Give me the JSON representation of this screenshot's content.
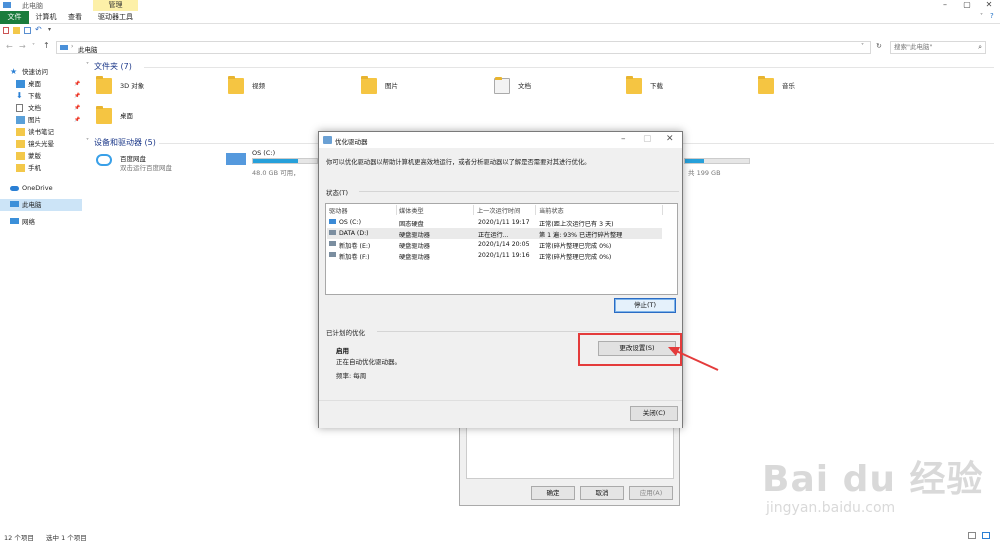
{
  "window": {
    "title": "此电脑",
    "manage_tab": "管理"
  },
  "ribbon": {
    "tabs": [
      "文件",
      "计算机",
      "查看",
      "驱动器工具"
    ]
  },
  "address": {
    "path": "此电脑",
    "search_placeholder": "搜索\"此电脑\""
  },
  "sidebar": {
    "items": [
      {
        "label": "快速访问",
        "level": 0
      },
      {
        "label": "桌面",
        "level": 1,
        "pinned": true
      },
      {
        "label": "下载",
        "level": 1,
        "pinned": true
      },
      {
        "label": "文档",
        "level": 1,
        "pinned": true
      },
      {
        "label": "图片",
        "level": 1,
        "pinned": true
      },
      {
        "label": "读书笔记",
        "level": 1
      },
      {
        "label": "镜头光晕",
        "level": 1
      },
      {
        "label": "蒙版",
        "level": 1
      },
      {
        "label": "手机",
        "level": 1
      },
      {
        "label": "OneDrive",
        "level": 0
      },
      {
        "label": "此电脑",
        "level": 0,
        "selected": true
      },
      {
        "label": "网络",
        "level": 0
      }
    ]
  },
  "folders": {
    "heading": "文件夹 (7)",
    "items": [
      "3D 对象",
      "视频",
      "图片",
      "文档",
      "下载",
      "音乐",
      "桌面"
    ]
  },
  "devices": {
    "heading": "设备和驱动器 (5)",
    "baidu": {
      "name": "百度网盘",
      "sub": "双击运行百度网盘"
    },
    "os": {
      "name": "OS (C:)",
      "free": "48.0 GB 可用，",
      "usage": 0.7
    },
    "right_partial": "共 199 GB"
  },
  "status_bar": {
    "count": "12 个项目",
    "selected": "选中 1 个项目"
  },
  "dialog": {
    "title": "优化驱动器",
    "description": "你可以优化驱动器以帮助计算机更高效地运行，或者分析驱动器以了解是否需要对其进行优化。",
    "status_label": "状态(T)",
    "columns": [
      "驱动器",
      "媒体类型",
      "上一次运行时间",
      "当前状态"
    ],
    "rows": [
      {
        "drive": "OS (C:)",
        "media": "固态硬盘",
        "last": "2020/1/11 19:17",
        "state": "正常(距上次运行已有 3 天)"
      },
      {
        "drive": "DATA (D:)",
        "media": "硬盘驱动器",
        "last": "正在运行...",
        "state": "第 1 遍: 93% 已进行碎片整理"
      },
      {
        "drive": "新加卷 (E:)",
        "media": "硬盘驱动器",
        "last": "2020/1/14 20:05",
        "state": "正常(碎片整理已完成 0%)"
      },
      {
        "drive": "新加卷 (F:)",
        "media": "硬盘驱动器",
        "last": "2020/1/11 19:16",
        "state": "正常(碎片整理已完成 0%)"
      }
    ],
    "stop_button": "停止(T)",
    "scheduled_label": "已计划的优化",
    "enabled": "启用",
    "auto_text": "正在自动优化驱动器。",
    "frequency": "频率: 每周",
    "change_button": "更改设置(S)",
    "close_button": "关闭(C)"
  },
  "back_dialog": {
    "ok": "确定",
    "cancel": "取消",
    "apply": "应用(A)"
  },
  "watermark": {
    "main": "Bai du 经验",
    "sub": "jingyan.baidu.com"
  },
  "colors": {
    "accent": "#26a0da",
    "file_tab": "#1a7c3c",
    "highlight": "#e43b3b"
  }
}
